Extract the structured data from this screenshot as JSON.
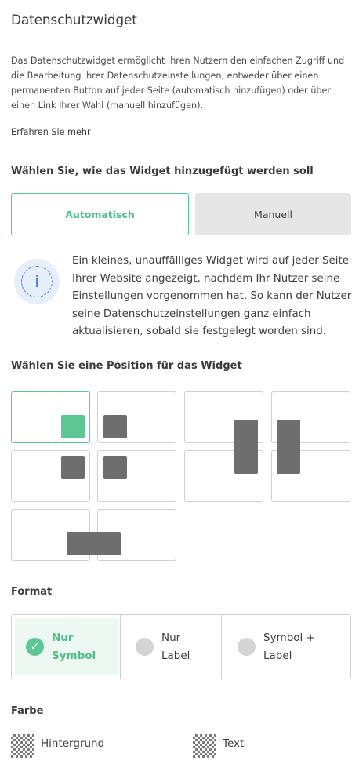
{
  "title": "Datenschutzwidget",
  "description": "Das Datenschutzwidget ermöglicht Ihren Nutzern den einfachen Zugriff und die Bearbeitung ihrer Datenschutzeinstellungen, entweder über einen permanenten Button auf jeder Seite (automatisch hinzufügen) oder über einen Link Ihrer Wahl (manuell hinzufügen).",
  "learn_more": "Erfahren Sie mehr",
  "add_mode": {
    "label": "Wählen Sie, wie das Widget hinzugefügt werden soll",
    "options": [
      "Automatisch",
      "Manuell"
    ],
    "selected": "Automatisch"
  },
  "info": {
    "icon": "info-icon",
    "text": "Ein kleines, unauffälliges Widget wird auf jeder Seite Ihrer Website angezeigt, nachdem Ihr Nutzer seine Einstellungen vorgenommen hat. So kann der Nutzer seine Datenschutzeinstellungen ganz einfach aktualisieren, sobald sie festgelegt worden sind."
  },
  "position": {
    "label": "Wählen Sie eine Position für das Widget"
  },
  "format": {
    "label": "Format",
    "options": [
      {
        "line1": "Nur",
        "line2": "Symbol"
      },
      {
        "line1": "Nur",
        "line2": "Label"
      },
      {
        "line1": "Symbol +",
        "line2": "Label"
      }
    ],
    "selected_index": 0
  },
  "color": {
    "label": "Farbe",
    "background": "Hintergrund",
    "text": "Text"
  },
  "colors": {
    "accent": "#5cc795",
    "info_blue": "#3d7ed8",
    "widget_gray": "#6e6e6e"
  }
}
